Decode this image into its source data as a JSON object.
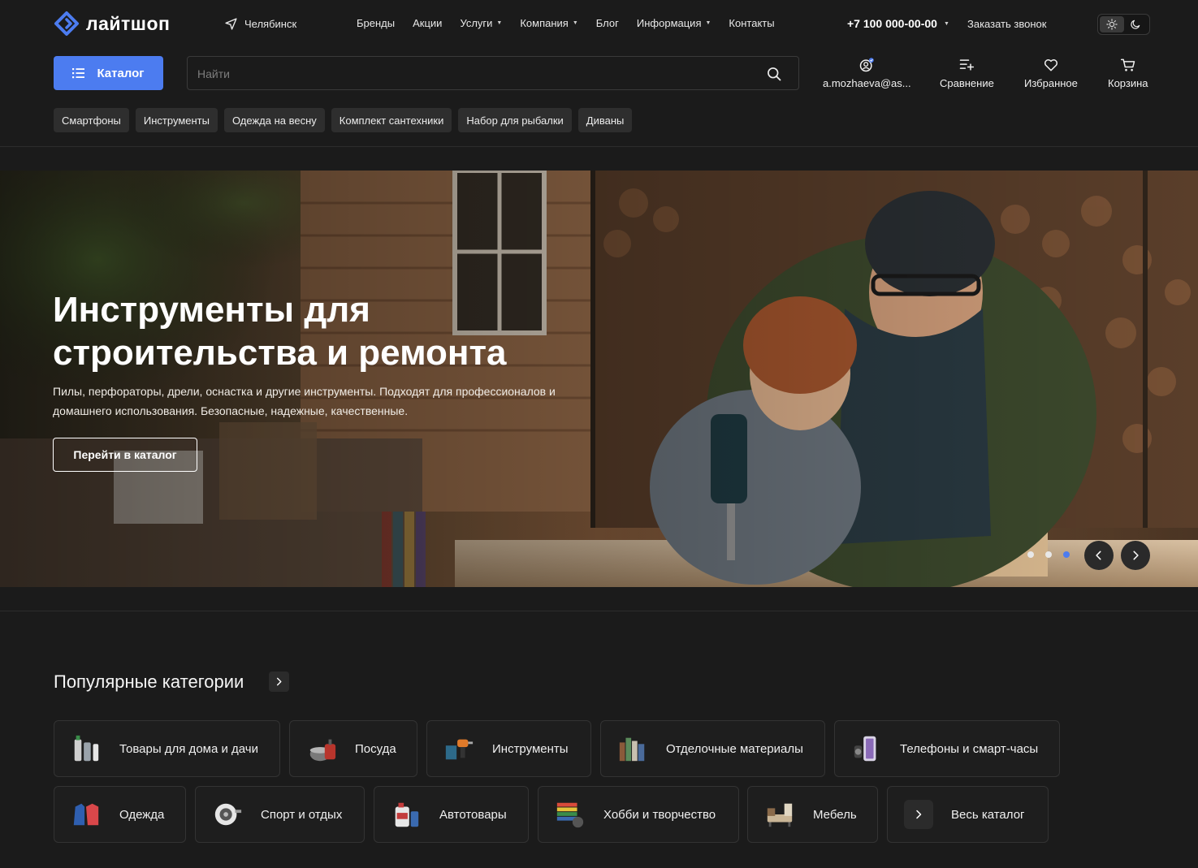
{
  "brand": {
    "name": "лайтшоп",
    "accent": "#4c7cf0"
  },
  "header": {
    "city": "Челябинск",
    "nav": [
      {
        "label": "Бренды",
        "dropdown": false
      },
      {
        "label": "Акции",
        "dropdown": false
      },
      {
        "label": "Услуги",
        "dropdown": true
      },
      {
        "label": "Компания",
        "dropdown": true
      },
      {
        "label": "Блог",
        "dropdown": false
      },
      {
        "label": "Информация",
        "dropdown": true
      },
      {
        "label": "Контакты",
        "dropdown": false
      }
    ],
    "phone": "+7 100 000-00-00",
    "callback": "Заказать звонок"
  },
  "toolbar": {
    "catalog_label": "Каталог",
    "search_placeholder": "Найти",
    "account_label": "a.mozhaeva@as...",
    "compare_label": "Сравнение",
    "favorites_label": "Избранное",
    "cart_label": "Корзина"
  },
  "tags": [
    "Смартфоны",
    "Инструменты",
    "Одежда на весну",
    "Комплект сантехники",
    "Набор для рыбалки",
    "Диваны"
  ],
  "hero": {
    "title": "Инструменты для строительства и ремонта",
    "subtitle": "Пилы, перфораторы, дрели, оснастка и другие инструменты. Подходят для профессионалов и домашнего использования. Безопасные, надежные, качественные.",
    "button_label": "Перейти в каталог",
    "slide_count": 3,
    "active_slide": 3
  },
  "categories": {
    "title": "Популярные категории",
    "items": [
      "Товары для дома и дачи",
      "Посуда",
      "Инструменты",
      "Отделочные материалы",
      "Телефоны и смарт-часы",
      "Одежда",
      "Спорт и отдых",
      "Автотовары",
      "Хобби и творчество",
      "Мебель",
      "Весь каталог"
    ]
  }
}
